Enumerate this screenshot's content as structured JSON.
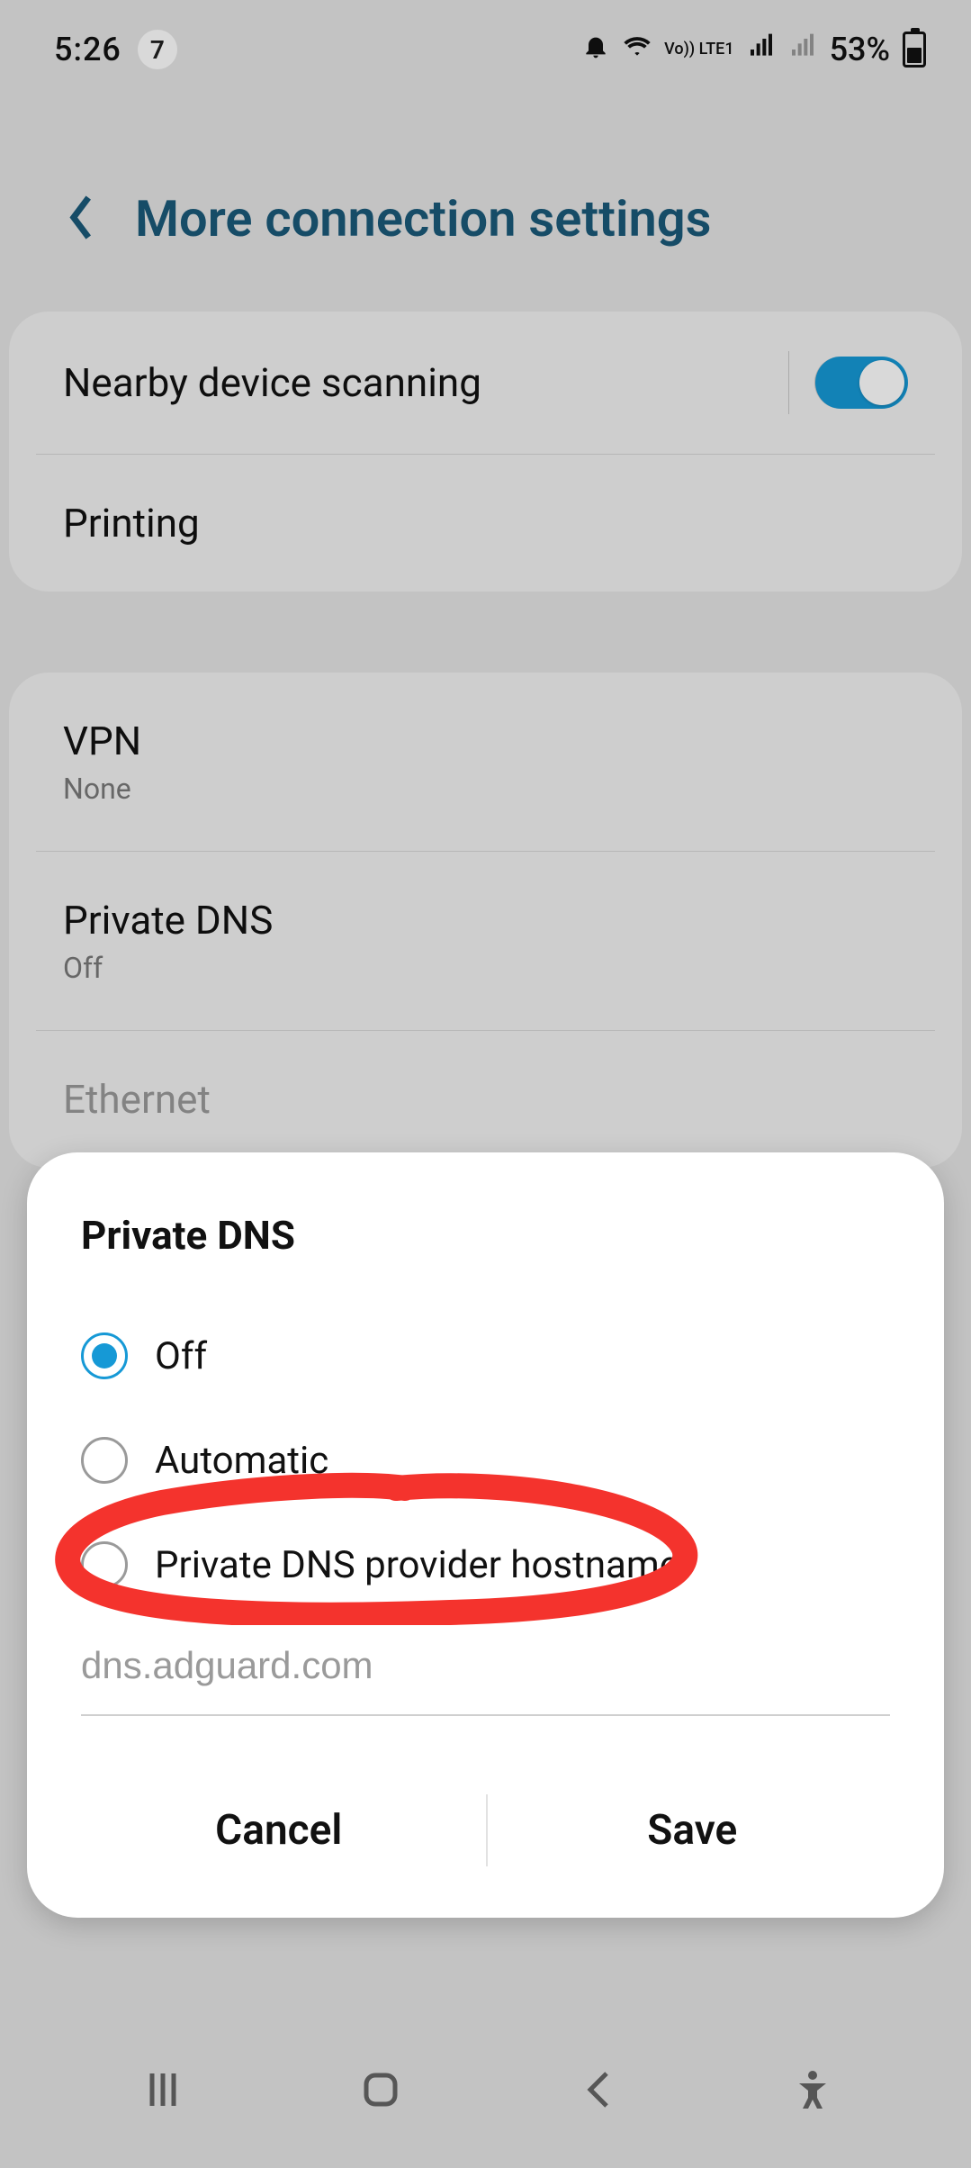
{
  "status_bar": {
    "time": "5:26",
    "notification_count": "7",
    "network_label": "Vo)) LTE1",
    "battery_percent": "53%"
  },
  "header": {
    "title": "More connection settings"
  },
  "cards": [
    {
      "rows": [
        {
          "title": "Nearby device scanning",
          "toggle": true
        },
        {
          "title": "Printing"
        }
      ]
    },
    {
      "rows": [
        {
          "title": "VPN",
          "sub": "None"
        },
        {
          "title": "Private DNS",
          "sub": "Off"
        },
        {
          "title": "Ethernet",
          "disabled": true
        }
      ]
    }
  ],
  "dialog": {
    "title": "Private DNS",
    "options": {
      "off": "Off",
      "automatic": "Automatic",
      "hostname": "Private DNS provider hostname"
    },
    "selected": "off",
    "input_value": "dns.adguard.com",
    "actions": {
      "cancel": "Cancel",
      "save": "Save"
    }
  },
  "colors": {
    "accent": "#1699d6",
    "header_text": "#1a5a7a",
    "annotation": "#f4332d"
  }
}
